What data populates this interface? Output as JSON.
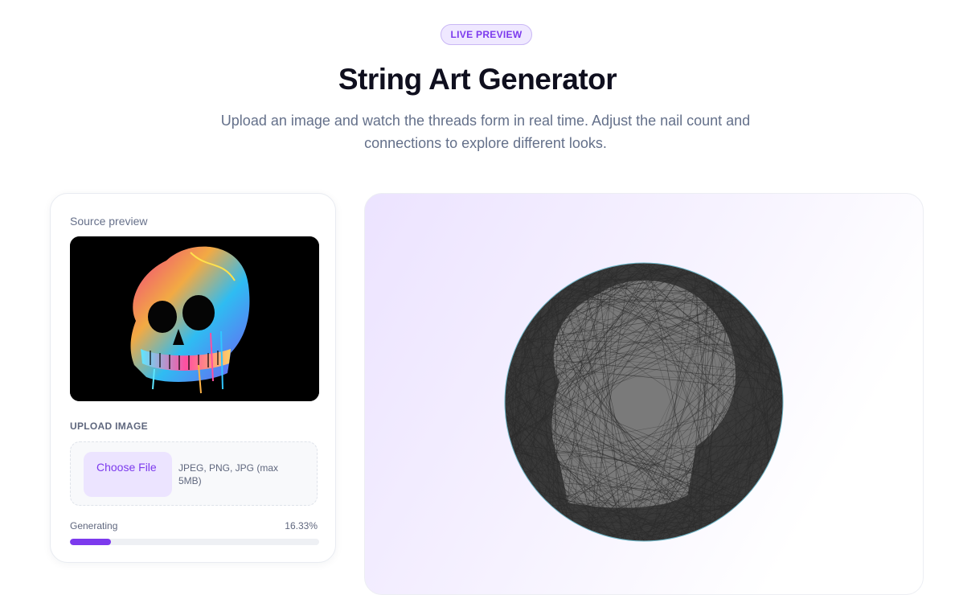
{
  "hero": {
    "badge": "LIVE PREVIEW",
    "title": "String Art Generator",
    "subtitle": "Upload an image and watch the threads form in real time. Adjust the nail count and connections to explore different looks."
  },
  "source": {
    "label": "Source preview"
  },
  "upload": {
    "label": "UPLOAD IMAGE",
    "button": "Choose File",
    "hint": "JPEG, PNG, JPG (max 5MB)"
  },
  "progress": {
    "label": "Generating",
    "value_text": "16.33%",
    "fraction": 0.1633
  },
  "colors": {
    "accent": "#7c3aed",
    "accent_soft": "#ece4ff",
    "thread": "#2b2b2b",
    "canvas_fill": "#7a7a7a"
  }
}
